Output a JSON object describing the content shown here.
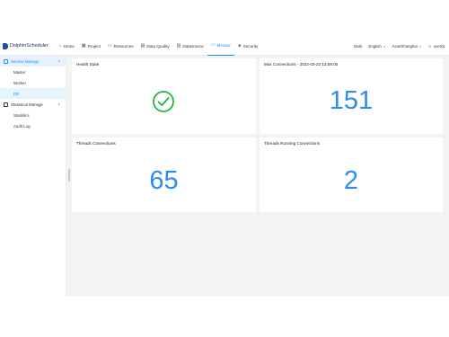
{
  "app": {
    "brand": "DolphinScheduler"
  },
  "nav": {
    "items": [
      {
        "label": "Home",
        "icon": "home-icon"
      },
      {
        "label": "Project",
        "icon": "project-icon"
      },
      {
        "label": "Resources",
        "icon": "folder-icon"
      },
      {
        "label": "Data Quality",
        "icon": "document-icon"
      },
      {
        "label": "Datasource",
        "icon": "database-icon"
      },
      {
        "label": "Monitor",
        "icon": "monitor-icon",
        "active": true
      },
      {
        "label": "Security",
        "icon": "shield-icon"
      }
    ]
  },
  "tools": {
    "theme": "Dark",
    "language": "English",
    "timezone": "Asia/Shanghai",
    "user": "user01"
  },
  "sidebar": {
    "groups": [
      {
        "label": "Service Manage",
        "items": [
          "Master",
          "Worker",
          "DB"
        ]
      },
      {
        "label": "Statistical Manage",
        "items": [
          "Statistics",
          "Audit Log"
        ]
      }
    ],
    "active_item": "DB"
  },
  "cards": {
    "health": {
      "title": "Health State"
    },
    "max_connections": {
      "title": "Max Connections - 2022-03-22 13:59:05",
      "value": "151"
    },
    "threads_connections": {
      "title": "Threads Connections",
      "value": "65"
    },
    "threads_running": {
      "title": "Threads Running Connections",
      "value": "2"
    }
  },
  "colors": {
    "accent": "#1890ff",
    "value": "#2d8cf0",
    "success": "#21b53b"
  }
}
